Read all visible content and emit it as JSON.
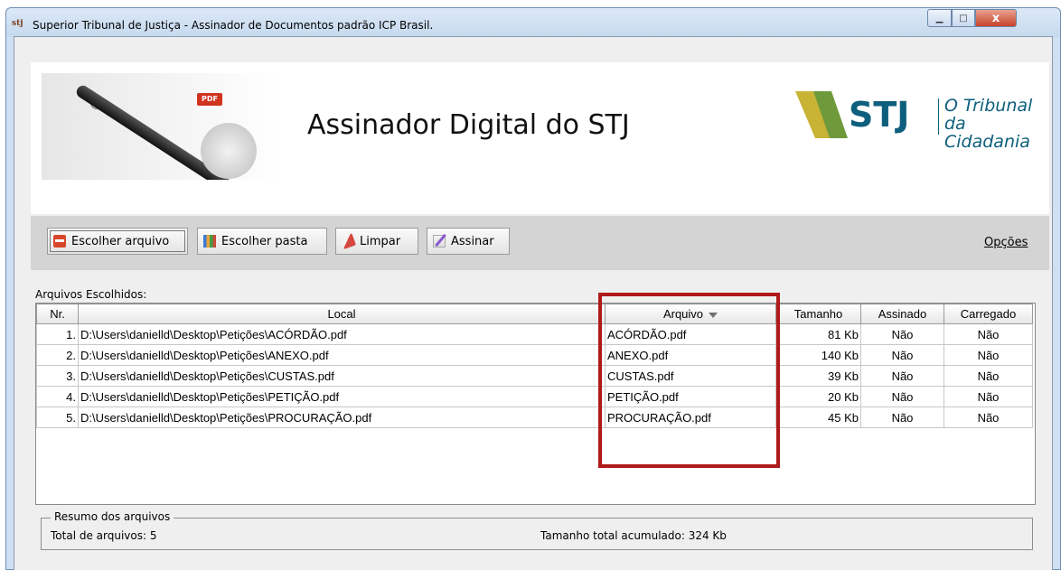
{
  "window": {
    "title": "Superior Tribunal de Justiça - Assinador de Documentos padrão ICP Brasil.",
    "icon_text": "stj",
    "min_glyph": "▁",
    "max_glyph": "□",
    "close_glyph": "x"
  },
  "banner": {
    "title": "Assinador Digital do STJ",
    "pdf_badge": "PDF",
    "logo_text": "STJ",
    "slogan_line1": "O Tribunal",
    "slogan_line2": "da Cidadania",
    "logo_color": "#0d5f7d"
  },
  "toolbar": {
    "buttons": [
      {
        "label": "Escolher arquivo",
        "icon": "pdf-file-icon"
      },
      {
        "label": "Escolher pasta",
        "icon": "folder-books-icon"
      },
      {
        "label": "Limpar",
        "icon": "eraser-icon"
      },
      {
        "label": "Assinar",
        "icon": "sign-pen-icon"
      }
    ],
    "options_label": "Opções"
  },
  "files": {
    "section_label": "Arquivos Escolhidos:",
    "columns": [
      "Nr.",
      "Local",
      "Arquivo",
      "Tamanho",
      "Assinado",
      "Carregado"
    ],
    "sorted_column": "Arquivo",
    "rows": [
      {
        "nr": "1.",
        "local": "D:\\Users\\danielld\\Desktop\\Petições\\ACÓRDÃO.pdf",
        "arquivo": "ACÓRDÃO.pdf",
        "tamanho": "81 Kb",
        "assinado": "Não",
        "carregado": "Não"
      },
      {
        "nr": "2.",
        "local": "D:\\Users\\danielld\\Desktop\\Petições\\ANEXO.pdf",
        "arquivo": "ANEXO.pdf",
        "tamanho": "140 Kb",
        "assinado": "Não",
        "carregado": "Não"
      },
      {
        "nr": "3.",
        "local": "D:\\Users\\danielld\\Desktop\\Petições\\CUSTAS.pdf",
        "arquivo": "CUSTAS.pdf",
        "tamanho": "39 Kb",
        "assinado": "Não",
        "carregado": "Não"
      },
      {
        "nr": "4.",
        "local": "D:\\Users\\danielld\\Desktop\\Petições\\PETIÇÃO.pdf",
        "arquivo": "PETIÇÃO.pdf",
        "tamanho": "20 Kb",
        "assinado": "Não",
        "carregado": "Não"
      },
      {
        "nr": "5.",
        "local": "D:\\Users\\danielld\\Desktop\\Petições\\PROCURAÇÃO.pdf",
        "arquivo": "PROCURAÇÃO.pdf",
        "tamanho": "45 Kb",
        "assinado": "Não",
        "carregado": "Não"
      }
    ],
    "highlight_color": "#b01a1a"
  },
  "summary": {
    "legend": "Resumo dos arquivos",
    "total_files": "Total de arquivos: 5",
    "total_size": "Tamanho total acumulado: 324 Kb"
  }
}
